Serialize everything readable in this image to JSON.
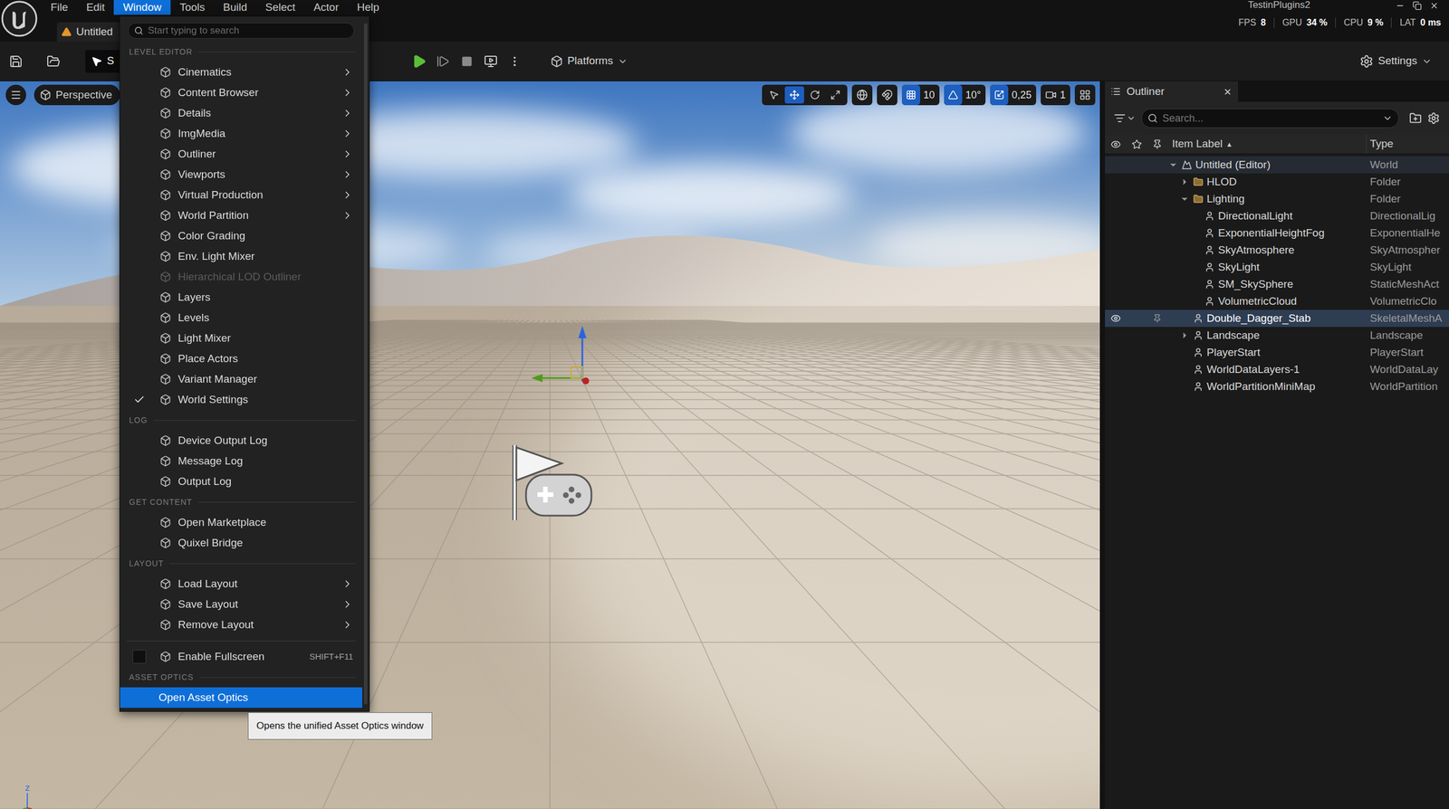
{
  "window": {
    "project": "TestinPlugins2",
    "tab": "Untitled"
  },
  "menubar": [
    {
      "label": "File",
      "selected": false
    },
    {
      "label": "Edit",
      "selected": false
    },
    {
      "label": "Window",
      "selected": true
    },
    {
      "label": "Tools",
      "selected": false
    },
    {
      "label": "Build",
      "selected": false
    },
    {
      "label": "Select",
      "selected": false
    },
    {
      "label": "Actor",
      "selected": false
    },
    {
      "label": "Help",
      "selected": false
    }
  ],
  "stats": [
    {
      "label": "FPS",
      "value": "8"
    },
    {
      "label": "GPU",
      "value": "34 %"
    },
    {
      "label": "CPU",
      "value": "9 %"
    },
    {
      "label": "LAT",
      "value": "0 ms"
    }
  ],
  "toolbar": {
    "mode_button": "S",
    "platforms": "Platforms",
    "settings": "Settings"
  },
  "viewport": {
    "view_mode": "Perspective",
    "grid_snap": "10",
    "rotation_snap": "10°",
    "scale_snap": "0,25",
    "camera_speed": "1",
    "axis_label": "z"
  },
  "window_menu": {
    "search_placeholder": "Start typing to search",
    "sections": [
      {
        "header": "LEVEL EDITOR",
        "items": [
          {
            "label": "Cinematics",
            "kind": "item",
            "submenu": true,
            "checked": false,
            "disabled": false,
            "selected": false
          },
          {
            "label": "Content Browser",
            "kind": "item",
            "submenu": true,
            "checked": false,
            "disabled": false,
            "selected": false
          },
          {
            "label": "Details",
            "kind": "item",
            "submenu": true,
            "checked": false,
            "disabled": false,
            "selected": false
          },
          {
            "label": "ImgMedia",
            "kind": "item",
            "submenu": true,
            "checked": false,
            "disabled": false,
            "selected": false
          },
          {
            "label": "Outliner",
            "kind": "item",
            "submenu": true,
            "checked": false,
            "disabled": false,
            "selected": false
          },
          {
            "label": "Viewports",
            "kind": "item",
            "submenu": true,
            "checked": false,
            "disabled": false,
            "selected": false
          },
          {
            "label": "Virtual Production",
            "kind": "item",
            "submenu": true,
            "checked": false,
            "disabled": false,
            "selected": false
          },
          {
            "label": "World Partition",
            "kind": "item",
            "submenu": true,
            "checked": false,
            "disabled": false,
            "selected": false
          },
          {
            "label": "Color Grading",
            "kind": "item",
            "submenu": false,
            "checked": false,
            "disabled": false,
            "selected": false
          },
          {
            "label": "Env. Light Mixer",
            "kind": "item",
            "submenu": false,
            "checked": false,
            "disabled": false,
            "selected": false
          },
          {
            "label": "Hierarchical LOD Outliner",
            "kind": "item",
            "submenu": false,
            "checked": false,
            "disabled": true,
            "selected": false
          },
          {
            "label": "Layers",
            "kind": "item",
            "submenu": false,
            "checked": false,
            "disabled": false,
            "selected": false
          },
          {
            "label": "Levels",
            "kind": "item",
            "submenu": false,
            "checked": false,
            "disabled": false,
            "selected": false
          },
          {
            "label": "Light Mixer",
            "kind": "item",
            "submenu": false,
            "checked": false,
            "disabled": false,
            "selected": false
          },
          {
            "label": "Place Actors",
            "kind": "item",
            "submenu": false,
            "checked": false,
            "disabled": false,
            "selected": false
          },
          {
            "label": "Variant Manager",
            "kind": "item",
            "submenu": false,
            "checked": false,
            "disabled": false,
            "selected": false
          },
          {
            "label": "World Settings",
            "kind": "item",
            "submenu": false,
            "checked": true,
            "disabled": false,
            "selected": false
          }
        ]
      },
      {
        "header": "LOG",
        "items": [
          {
            "label": "Device Output Log",
            "kind": "item",
            "submenu": false,
            "checked": false,
            "disabled": false,
            "selected": false
          },
          {
            "label": "Message Log",
            "kind": "item",
            "submenu": false,
            "checked": false,
            "disabled": false,
            "selected": false
          },
          {
            "label": "Output Log",
            "kind": "item",
            "submenu": false,
            "checked": false,
            "disabled": false,
            "selected": false
          }
        ]
      },
      {
        "header": "GET CONTENT",
        "items": [
          {
            "label": "Open Marketplace",
            "kind": "item",
            "submenu": false,
            "checked": false,
            "disabled": false,
            "selected": false
          },
          {
            "label": "Quixel Bridge",
            "kind": "item",
            "submenu": false,
            "checked": false,
            "disabled": false,
            "selected": false
          }
        ]
      },
      {
        "header": "LAYOUT",
        "items": [
          {
            "label": "Load Layout",
            "kind": "item",
            "submenu": true,
            "checked": false,
            "disabled": false,
            "selected": false
          },
          {
            "label": "Save Layout",
            "kind": "item",
            "submenu": true,
            "checked": false,
            "disabled": false,
            "selected": false
          },
          {
            "label": "Remove Layout",
            "kind": "item",
            "submenu": true,
            "checked": false,
            "disabled": false,
            "selected": false
          }
        ]
      },
      {
        "items": [
          {
            "label": "Enable Fullscreen",
            "kind": "checkbox",
            "submenu": false,
            "checked": false,
            "disabled": false,
            "selected": false,
            "shortcut": "SHIFT+F11"
          }
        ]
      },
      {
        "header": "ASSET OPTICS",
        "items": [
          {
            "label": "Open Asset Optics",
            "kind": "plain",
            "submenu": false,
            "checked": false,
            "disabled": false,
            "selected": true
          }
        ]
      }
    ]
  },
  "tooltip": {
    "text": "Opens the unified Asset Optics window"
  },
  "outliner": {
    "title": "Outliner",
    "close": "×",
    "search_placeholder": "Search...",
    "columns": {
      "label": "Item Label",
      "sort": "▲",
      "type": "Type"
    },
    "rows": [
      {
        "label": "Untitled (Editor)",
        "type": "World",
        "depth": 0,
        "kind": "world",
        "expandable": true,
        "expanded": true,
        "highlighted": true,
        "selected": false
      },
      {
        "label": "HLOD",
        "type": "Folder",
        "depth": 1,
        "kind": "folder",
        "expandable": true,
        "expanded": false,
        "highlighted": false,
        "selected": false
      },
      {
        "label": "Lighting",
        "type": "Folder",
        "depth": 1,
        "kind": "folder",
        "expandable": true,
        "expanded": true,
        "highlighted": false,
        "selected": false
      },
      {
        "label": "DirectionalLight",
        "type": "DirectionalLig",
        "depth": 2,
        "kind": "actor",
        "expandable": false,
        "expanded": false,
        "highlighted": false,
        "selected": false
      },
      {
        "label": "ExponentialHeightFog",
        "type": "ExponentialHe",
        "depth": 2,
        "kind": "actor",
        "expandable": false,
        "expanded": false,
        "highlighted": false,
        "selected": false
      },
      {
        "label": "SkyAtmosphere",
        "type": "SkyAtmospher",
        "depth": 2,
        "kind": "actor",
        "expandable": false,
        "expanded": false,
        "highlighted": false,
        "selected": false
      },
      {
        "label": "SkyLight",
        "type": "SkyLight",
        "depth": 2,
        "kind": "actor",
        "expandable": false,
        "expanded": false,
        "highlighted": false,
        "selected": false
      },
      {
        "label": "SM_SkySphere",
        "type": "StaticMeshAct",
        "depth": 2,
        "kind": "actor",
        "expandable": false,
        "expanded": false,
        "highlighted": false,
        "selected": false
      },
      {
        "label": "VolumetricCloud",
        "type": "VolumetricClo",
        "depth": 2,
        "kind": "actor",
        "expandable": false,
        "expanded": false,
        "highlighted": false,
        "selected": false
      },
      {
        "label": "Double_Dagger_Stab",
        "type": "SkeletalMeshA",
        "depth": 1,
        "kind": "actor",
        "expandable": false,
        "expanded": false,
        "highlighted": false,
        "selected": true
      },
      {
        "label": "Landscape",
        "type": "Landscape",
        "depth": 1,
        "kind": "actor",
        "expandable": true,
        "expanded": false,
        "highlighted": false,
        "selected": false
      },
      {
        "label": "PlayerStart",
        "type": "PlayerStart",
        "depth": 1,
        "kind": "actor",
        "expandable": false,
        "expanded": false,
        "highlighted": false,
        "selected": false
      },
      {
        "label": "WorldDataLayers-1",
        "type": "WorldDataLay",
        "depth": 1,
        "kind": "actor",
        "expandable": false,
        "expanded": false,
        "highlighted": false,
        "selected": false
      },
      {
        "label": "WorldPartitionMiniMap",
        "type": "WorldPartition",
        "depth": 1,
        "kind": "actor",
        "expandable": false,
        "expanded": false,
        "highlighted": false,
        "selected": false
      }
    ]
  }
}
